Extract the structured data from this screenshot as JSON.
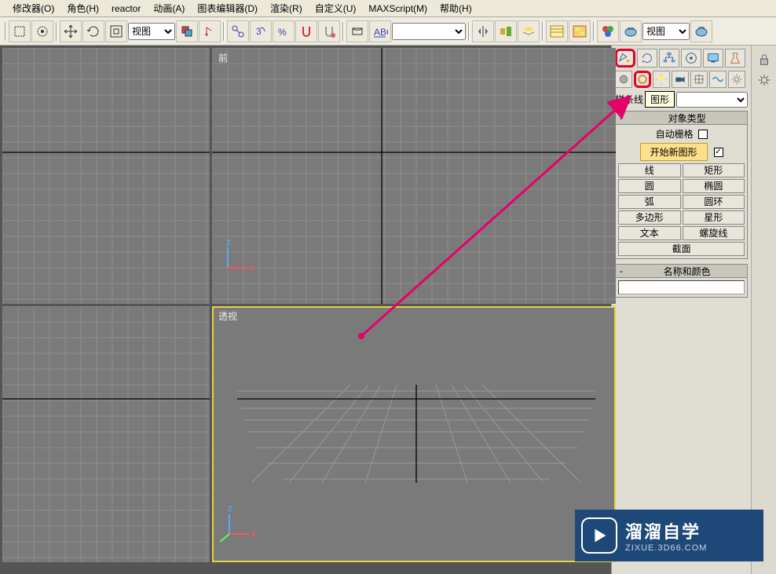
{
  "menu": [
    "修改器(O)",
    "角色(H)",
    "reactor",
    "动画(A)",
    "图表编辑器(D)",
    "渲染(R)",
    "自定义(U)",
    "MAXScript(M)",
    "帮助(H)"
  ],
  "toolbar": {
    "view_text": "视图"
  },
  "viewports": {
    "top_right_label": "前",
    "bottom_right_label": "透视"
  },
  "panel": {
    "dd_label": "样条线",
    "tooltip": "图形",
    "rollout_type_title": "对象类型",
    "auto_grid": "自动栅格",
    "start_new": "开始新图形",
    "buttons": [
      "线",
      "矩形",
      "圆",
      "椭圆",
      "弧",
      "圆环",
      "多边形",
      "星形",
      "文本",
      "螺旋线",
      "截面"
    ],
    "rollout_name_title": "名称和颜色"
  },
  "watermark": {
    "title": "溜溜自学",
    "sub": "ZIXUE.3D66.COM"
  }
}
